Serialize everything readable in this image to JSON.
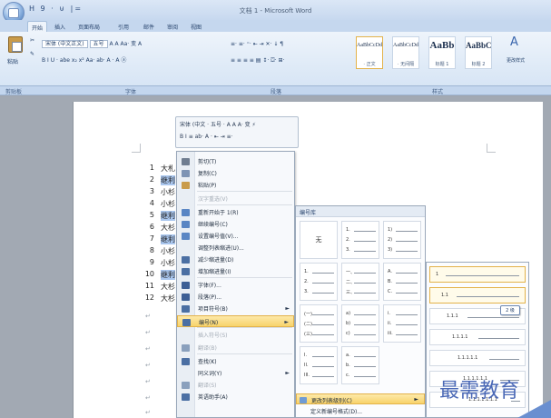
{
  "window": {
    "title": "文档 1 - Microsoft Word",
    "qat": "H 9 · ⊍ |="
  },
  "tabs": [
    "开始",
    "插入",
    "页面布局",
    "引用",
    "邮件",
    "审阅",
    "视图"
  ],
  "ribbon": {
    "paste_label": "粘贴",
    "font_name": "宋体 (中文正文)",
    "font_size": "五号",
    "font_row1_extra": "A A Aa· 变 A",
    "font_row2": "B I U · abe x₂ x² Aa· ab· A · A ⓐ",
    "para_row1": "≡· ≡· ⁼· ⇤ ⇥ ✕· ↓ ¶",
    "para_row2": "≡ ≡ ≡ ≡ ▤ ↕· ⛋· ⊞·",
    "styles": [
      {
        "sample": "AaBbCcDd",
        "name": "· 正文"
      },
      {
        "sample": "AaBbCcDd",
        "name": "· 无间隔"
      },
      {
        "sample": "AaBb",
        "name": "标题 1"
      },
      {
        "sample": "AaBbC",
        "name": "标题 2"
      }
    ],
    "change_styles": "更改样式",
    "group_labels": [
      "剪贴板",
      "字体",
      "段落",
      "样式"
    ]
  },
  "mini_toolbar": {
    "row1": "宋体 (中文 · 五号 · A A A· 变 ⚡",
    "row2": "B I ≡ ab· A · ⇤ ⇥ ≡·"
  },
  "document": {
    "lines": [
      {
        "n": "1",
        "text": "大札",
        "hl": false
      },
      {
        "n": "2",
        "text": "继利",
        "hl": true
      },
      {
        "n": "3",
        "text": "小杉",
        "hl": false
      },
      {
        "n": "4",
        "text": "小杉",
        "hl": false
      },
      {
        "n": "5",
        "text": "继利",
        "hl": true
      },
      {
        "n": "6",
        "text": "大杉",
        "hl": false
      },
      {
        "n": "7",
        "text": "继利",
        "hl": true
      },
      {
        "n": "8",
        "text": "小杉",
        "hl": false
      },
      {
        "n": "9",
        "text": "小杉",
        "hl": false
      },
      {
        "n": "10",
        "text": "继利",
        "hl": true
      },
      {
        "n": "11",
        "text": "大杉",
        "hl": false
      },
      {
        "n": "12",
        "text": "大杉",
        "hl": false
      }
    ],
    "return_mark": "↵"
  },
  "context_menu": {
    "items": [
      {
        "label": "剪切(T)",
        "icon": "scissors-icon",
        "color": "#6f7d90"
      },
      {
        "label": "复制(C)",
        "icon": "copy-icon",
        "color": "#7d93b4"
      },
      {
        "label": "粘贴(P)",
        "icon": "paste-icon",
        "color": "#c99b4a"
      },
      {
        "label": "汉字重选(V)",
        "icon": "",
        "color": "",
        "disabled": true
      },
      {
        "label": "重新开始于 1(R)",
        "icon": "restart-numbering-icon",
        "color": "#5a86c4"
      },
      {
        "label": "继续编号(C)",
        "icon": "continue-numbering-icon",
        "color": "#5a86c4"
      },
      {
        "label": "设置编号值(V)...",
        "icon": "set-value-icon",
        "color": "#5a86c4"
      },
      {
        "label": "调整列表缩进(U)...",
        "icon": "",
        "color": ""
      },
      {
        "label": "减少缩进量(D)",
        "icon": "decrease-indent-icon",
        "color": "#4b6fa3"
      },
      {
        "label": "增加缩进量(I)",
        "icon": "increase-indent-icon",
        "color": "#4b6fa3"
      },
      {
        "label": "字体(F)...",
        "icon": "font-icon",
        "color": "#3d5f95"
      },
      {
        "label": "段落(P)...",
        "icon": "paragraph-icon",
        "color": "#3d5f95"
      },
      {
        "label": "项目符号(B)",
        "icon": "bullets-icon",
        "color": "#4b6fa3",
        "arrow": true
      },
      {
        "label": "编号(N)",
        "icon": "numbering-icon",
        "color": "#4b6fa3",
        "arrow": true,
        "hot": true
      },
      {
        "label": "插入符号(S)",
        "icon": "",
        "color": "",
        "disabled": true
      },
      {
        "label": "翻译(B)",
        "icon": "translate-icon",
        "color": "#8aa0bd",
        "disabled": true
      },
      {
        "label": "查找(K)",
        "icon": "lookup-icon",
        "color": "#4b6fa3"
      },
      {
        "label": "同义词(Y)",
        "icon": "",
        "color": "",
        "arrow": true
      },
      {
        "label": "翻译(S)",
        "icon": "translate-2-icon",
        "color": "#8aa0bd",
        "disabled": true
      },
      {
        "label": "英语助手(A)",
        "icon": "english-assistant-icon",
        "color": "#4b6fa3"
      }
    ]
  },
  "numbering_library": {
    "header": "编号库",
    "none_label": "无",
    "cells": [
      [
        "1.",
        "2.",
        "3."
      ],
      [
        "1)",
        "2)",
        "3)"
      ],
      [
        "1.",
        "2.",
        "3."
      ],
      [
        "一、",
        "二、",
        "三、"
      ],
      [
        "A.",
        "B.",
        "C."
      ],
      [
        "(一)",
        "(二)",
        "(三)"
      ],
      [
        "a)",
        "b)",
        "c)"
      ],
      [
        "i.",
        "ii.",
        "iii."
      ],
      [
        "I.",
        "II.",
        "III."
      ],
      [
        "a.",
        "b.",
        "c."
      ]
    ],
    "footer_change_level": "更改列表级别(C)",
    "footer_define_new": "定义新编号格式(D)..."
  },
  "level_submenu": {
    "items": [
      "1",
      "1.1",
      "1.1.1",
      "1.1.1.1",
      "1.1.1.1.1",
      "1.1.1.1.1.1",
      "1.1.1.1.1.1.1"
    ],
    "tooltip": "2 级"
  },
  "watermark": "最需教育"
}
